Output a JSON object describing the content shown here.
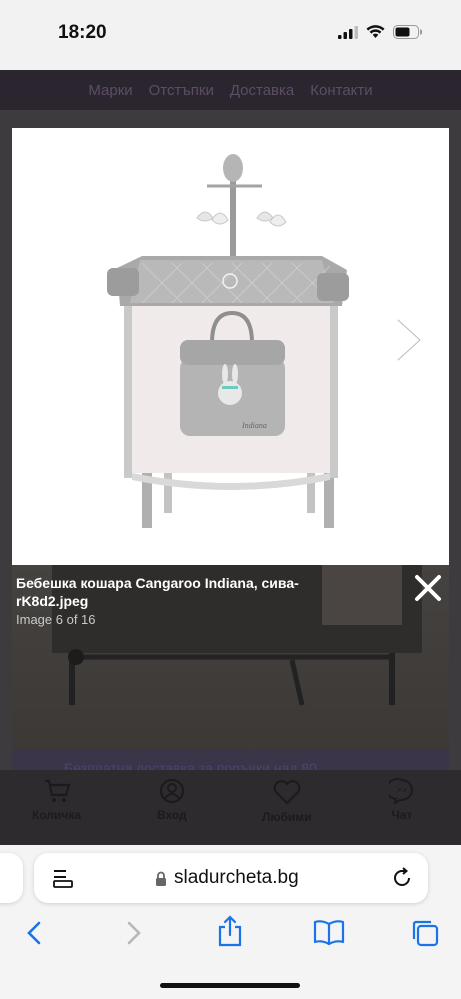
{
  "status_bar": {
    "time": "18:20"
  },
  "site_nav": {
    "items": [
      "Марки",
      "Отстъпки",
      "Доставка",
      "Контакти"
    ]
  },
  "lightbox": {
    "title": "Бебешка кошара Cangaroo Indiana, сива-rK8d2.jpeg",
    "counter": "Image 6 of 16",
    "bag_text": "Indiana"
  },
  "promo_text": "Безплатна доставка за поръчки над 80",
  "bottom_bar": {
    "items": [
      {
        "label": "Количка",
        "icon": "cart-icon"
      },
      {
        "label": "Вход",
        "icon": "user-icon"
      },
      {
        "label": "Любими",
        "icon": "heart-icon"
      },
      {
        "label": "Чат",
        "icon": "messenger-icon"
      }
    ]
  },
  "browser": {
    "url": "sladurcheta.bg"
  }
}
